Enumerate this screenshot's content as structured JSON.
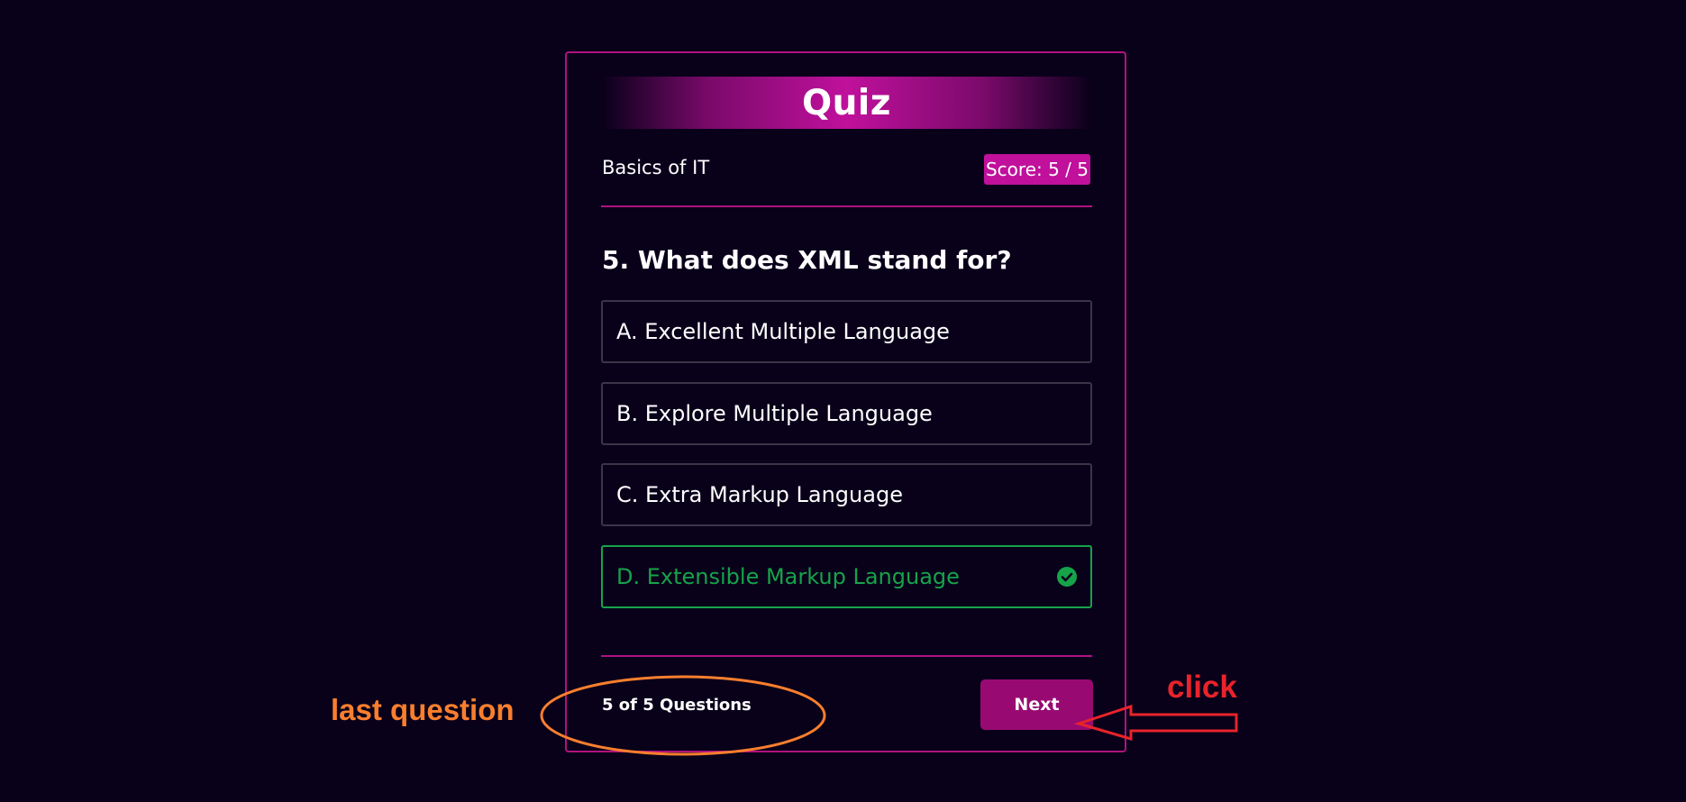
{
  "quiz": {
    "title": "Quiz",
    "topic": "Basics of IT",
    "score": "Score: 5 / 5",
    "question": "5. What does XML stand for?",
    "options": [
      {
        "label": "A. Excellent Multiple Language",
        "state": "default"
      },
      {
        "label": "B. Explore Multiple Language",
        "state": "default"
      },
      {
        "label": "C. Extra Markup Language",
        "state": "default"
      },
      {
        "label": "D. Extensible Markup Language",
        "state": "correct"
      }
    ],
    "progress": "5 of 5 Questions",
    "next_label": "Next"
  },
  "annotations": {
    "last_question": "last question",
    "click": "click"
  },
  "colors": {
    "background": "#09001a",
    "accent": "#c0109c",
    "button": "#980a72",
    "correct": "#16a34a",
    "annotation_orange": "#f97f2e",
    "annotation_red": "#e8232a"
  },
  "icons": {
    "correct_option": "check-circle-icon"
  }
}
